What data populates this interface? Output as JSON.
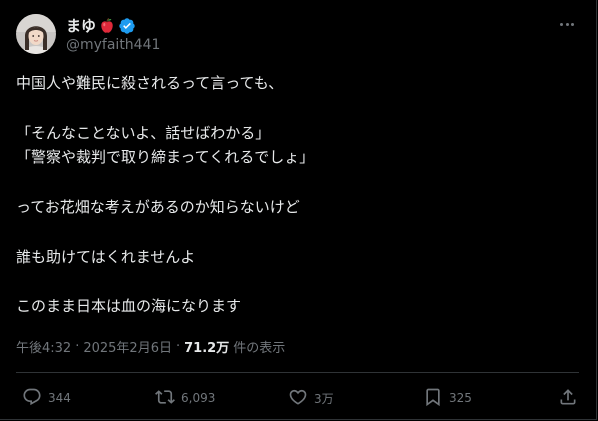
{
  "author": {
    "display_name": "まゆ",
    "handle": "@myfaith441"
  },
  "tweet": {
    "lines": [
      "中国人や難民に殺されるって言っても、",
      "",
      "「そんなことないよ、話せばわかる」",
      "「警察や裁判で取り締まってくれるでしょ」",
      "",
      "ってお花畑な考えがあるのか知らないけど",
      "",
      "誰も助けてはくれませんよ",
      "",
      "このまま日本は血の海になります"
    ]
  },
  "meta": {
    "time": "午後4:32",
    "separator1": "·",
    "date": "2025年2月6日",
    "separator2": "·",
    "views_count": "71.2万",
    "views_label": "件の表示"
  },
  "actions": {
    "reply_count": "344",
    "retweet_count": "6,093",
    "like_count": "3万",
    "bookmark_count": "325"
  },
  "colors": {
    "background": "#000000",
    "text": "#e7e9ea",
    "muted": "#71767b",
    "verified": "#1d9bf0",
    "border": "#2f3336"
  }
}
